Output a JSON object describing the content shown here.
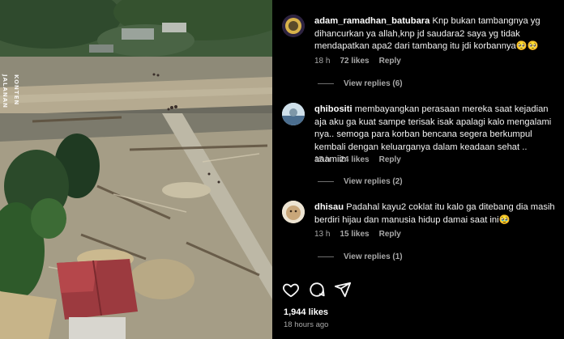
{
  "media": {
    "watermark_top": "KONTEN",
    "watermark_bottom": "JALANAN"
  },
  "comments": [
    {
      "username": "adam_ramadhan_batubara",
      "text": "Knp bukan tambangnya yg dihancurkan ya allah,knp jd saudara2 saya yg tidak mendapatkan apa2 dari tambang itu jdi korbannya🥺🥺",
      "time": "18 h",
      "likes": "72 likes",
      "reply": "Reply",
      "view_replies": "View replies (6)",
      "avatar_colors": [
        "#d8b24a",
        "#3a2a55"
      ]
    },
    {
      "username": "qhibositi",
      "text": "membayangkan perasaan mereka saat kejadian aja aku ga kuat sampe terisak isak apalagi kalo mengalami nya.. semoga para korban bencana segera berkumpul kembali dengan keluarganya dalam keadaan sehat .. aaamiin",
      "time": "15 h",
      "likes": "24 likes",
      "reply": "Reply",
      "view_replies": "View replies (2)",
      "avatar_colors": [
        "#bcd2e0",
        "#4b6e8f"
      ]
    },
    {
      "username": "dhisau",
      "text": "Padahal kayu2 coklat itu kalo ga ditebang dia masih berdiri hijau dan manusia hidup damai saat ini🥹",
      "time": "13 h",
      "likes": "15 likes",
      "reply": "Reply",
      "view_replies": "View replies (1)",
      "avatar_colors": [
        "#e9e0cf",
        "#b89870"
      ]
    }
  ],
  "actions": {
    "like_icon": "heart-icon",
    "comment_icon": "comment-icon",
    "share_icon": "share-icon"
  },
  "footer": {
    "likes_total": "1,944 likes",
    "time_ago": "18 hours ago"
  }
}
